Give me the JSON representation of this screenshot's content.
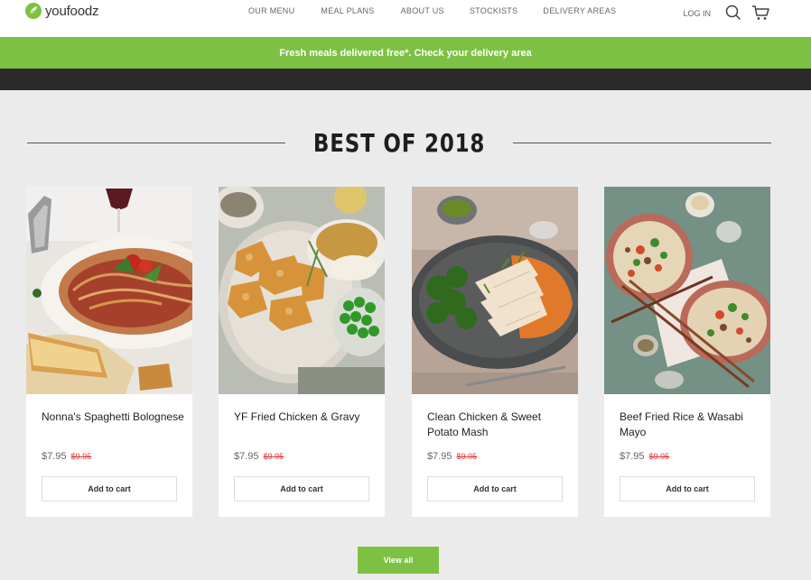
{
  "brand": {
    "name": "youfoodz",
    "accent": "#7cc143"
  },
  "nav": {
    "items": [
      {
        "label": "OUR MENU"
      },
      {
        "label": "MEAL PLANS"
      },
      {
        "label": "ABOUT US"
      },
      {
        "label": "STOCKISTS"
      },
      {
        "label": "DELIVERY AREAS"
      }
    ],
    "login": "LOG IN",
    "icons": [
      "search-icon",
      "cart-icon"
    ]
  },
  "promo": {
    "text": "Fresh meals delivered free*. Check your delivery area"
  },
  "section": {
    "title": "BEST OF 2018"
  },
  "products": [
    {
      "name": "Nonna's Spaghetti Bolognese",
      "price": "$7.95",
      "old_price": "$9.95",
      "cta": "Add to cart"
    },
    {
      "name": "YF Fried Chicken & Gravy",
      "price": "$7.95",
      "old_price": "$9.95",
      "cta": "Add to cart"
    },
    {
      "name": "Clean Chicken & Sweet Potato Mash",
      "price": "$7.95",
      "old_price": "$9.95",
      "cta": "Add to cart"
    },
    {
      "name": "Beef Fried Rice & Wasabi Mayo",
      "price": "$7.95",
      "old_price": "$9.95",
      "cta": "Add to cart"
    }
  ],
  "view_all": "View all"
}
